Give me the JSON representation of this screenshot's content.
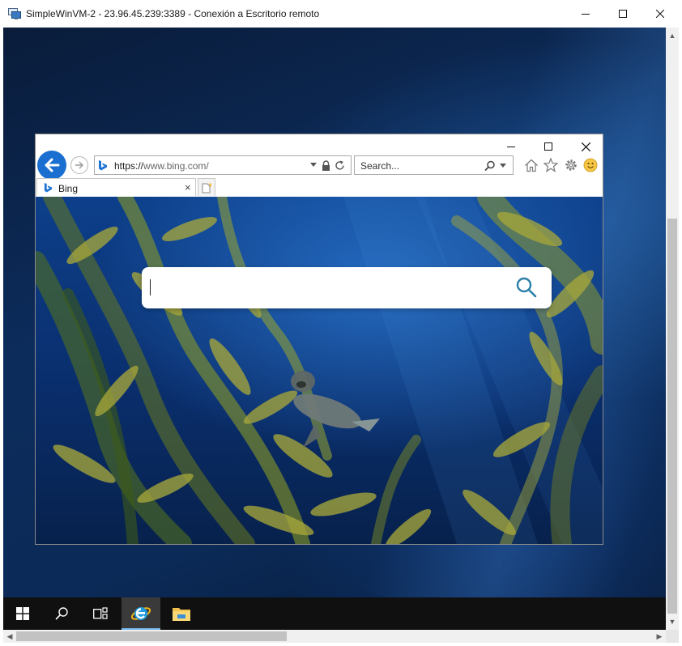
{
  "rdp": {
    "title": "SimpleWinVM-2 - 23.96.45.239:3389 - Conexión a Escritorio remoto",
    "minimize_icon": "minimize-icon",
    "maximize_icon": "maximize-icon",
    "close_icon": "close-icon"
  },
  "ie": {
    "address_url_scheme": "https://",
    "address_url_host": "www.bing.com/",
    "search_placeholder": "Search...",
    "tab_label": "Bing",
    "tab_close": "×",
    "toolbar_icons": [
      "home-icon",
      "favorites-star-icon",
      "settings-gear-icon",
      "feedback-smiley-icon"
    ]
  },
  "bing": {
    "search_value": ""
  },
  "taskbar": {
    "items": [
      "start-windows-icon",
      "search-icon",
      "task-view-icon",
      "internet-explorer-icon",
      "file-explorer-icon"
    ]
  },
  "colors": {
    "ie_accent": "#1a6fd0",
    "bing_icon": "#2a7fa8",
    "taskbar": "#101010"
  }
}
